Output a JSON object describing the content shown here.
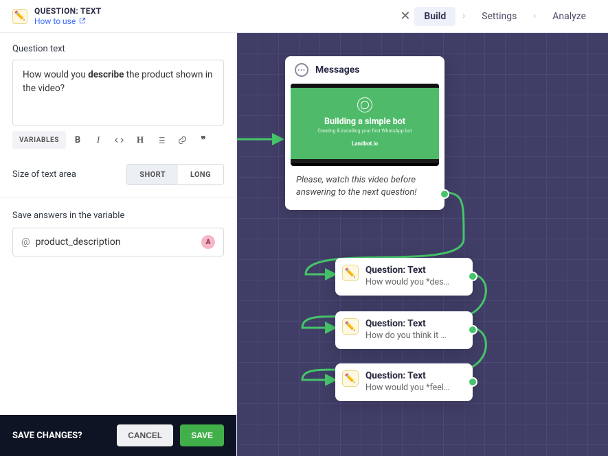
{
  "panel": {
    "title": "QUESTION: TEXT",
    "how_to_use": "How to use",
    "question_label": "Question text",
    "question_html": "How would you <b>describe</b> the product shown in the video?",
    "variables_btn": "VARIABLES",
    "size_label": "Size of text area",
    "size_short": "SHORT",
    "size_long": "LONG",
    "size_selected": "short",
    "save_var_label": "Save answers in the variable",
    "variable_name": "product_description",
    "variable_type_badge": "A",
    "footer_question": "SAVE CHANGES?",
    "cancel": "CANCEL",
    "save": "SAVE"
  },
  "topnav": {
    "build": "Build",
    "settings": "Settings",
    "analyze": "Analyze",
    "active": "build"
  },
  "canvas": {
    "messages": {
      "title": "Messages",
      "video_title": "Building a simple bot",
      "video_sub": "Creating & installing your first WhatsApp bot",
      "video_brand": "Landbot.io",
      "caption": "Please, watch this video before answering to the next question!"
    },
    "nodes": [
      {
        "title": "Question: Text",
        "subtitle": "How would you *des…"
      },
      {
        "title": "Question: Text",
        "subtitle": "How do you think it …"
      },
      {
        "title": "Question: Text",
        "subtitle": "How would you *feel…"
      }
    ]
  }
}
